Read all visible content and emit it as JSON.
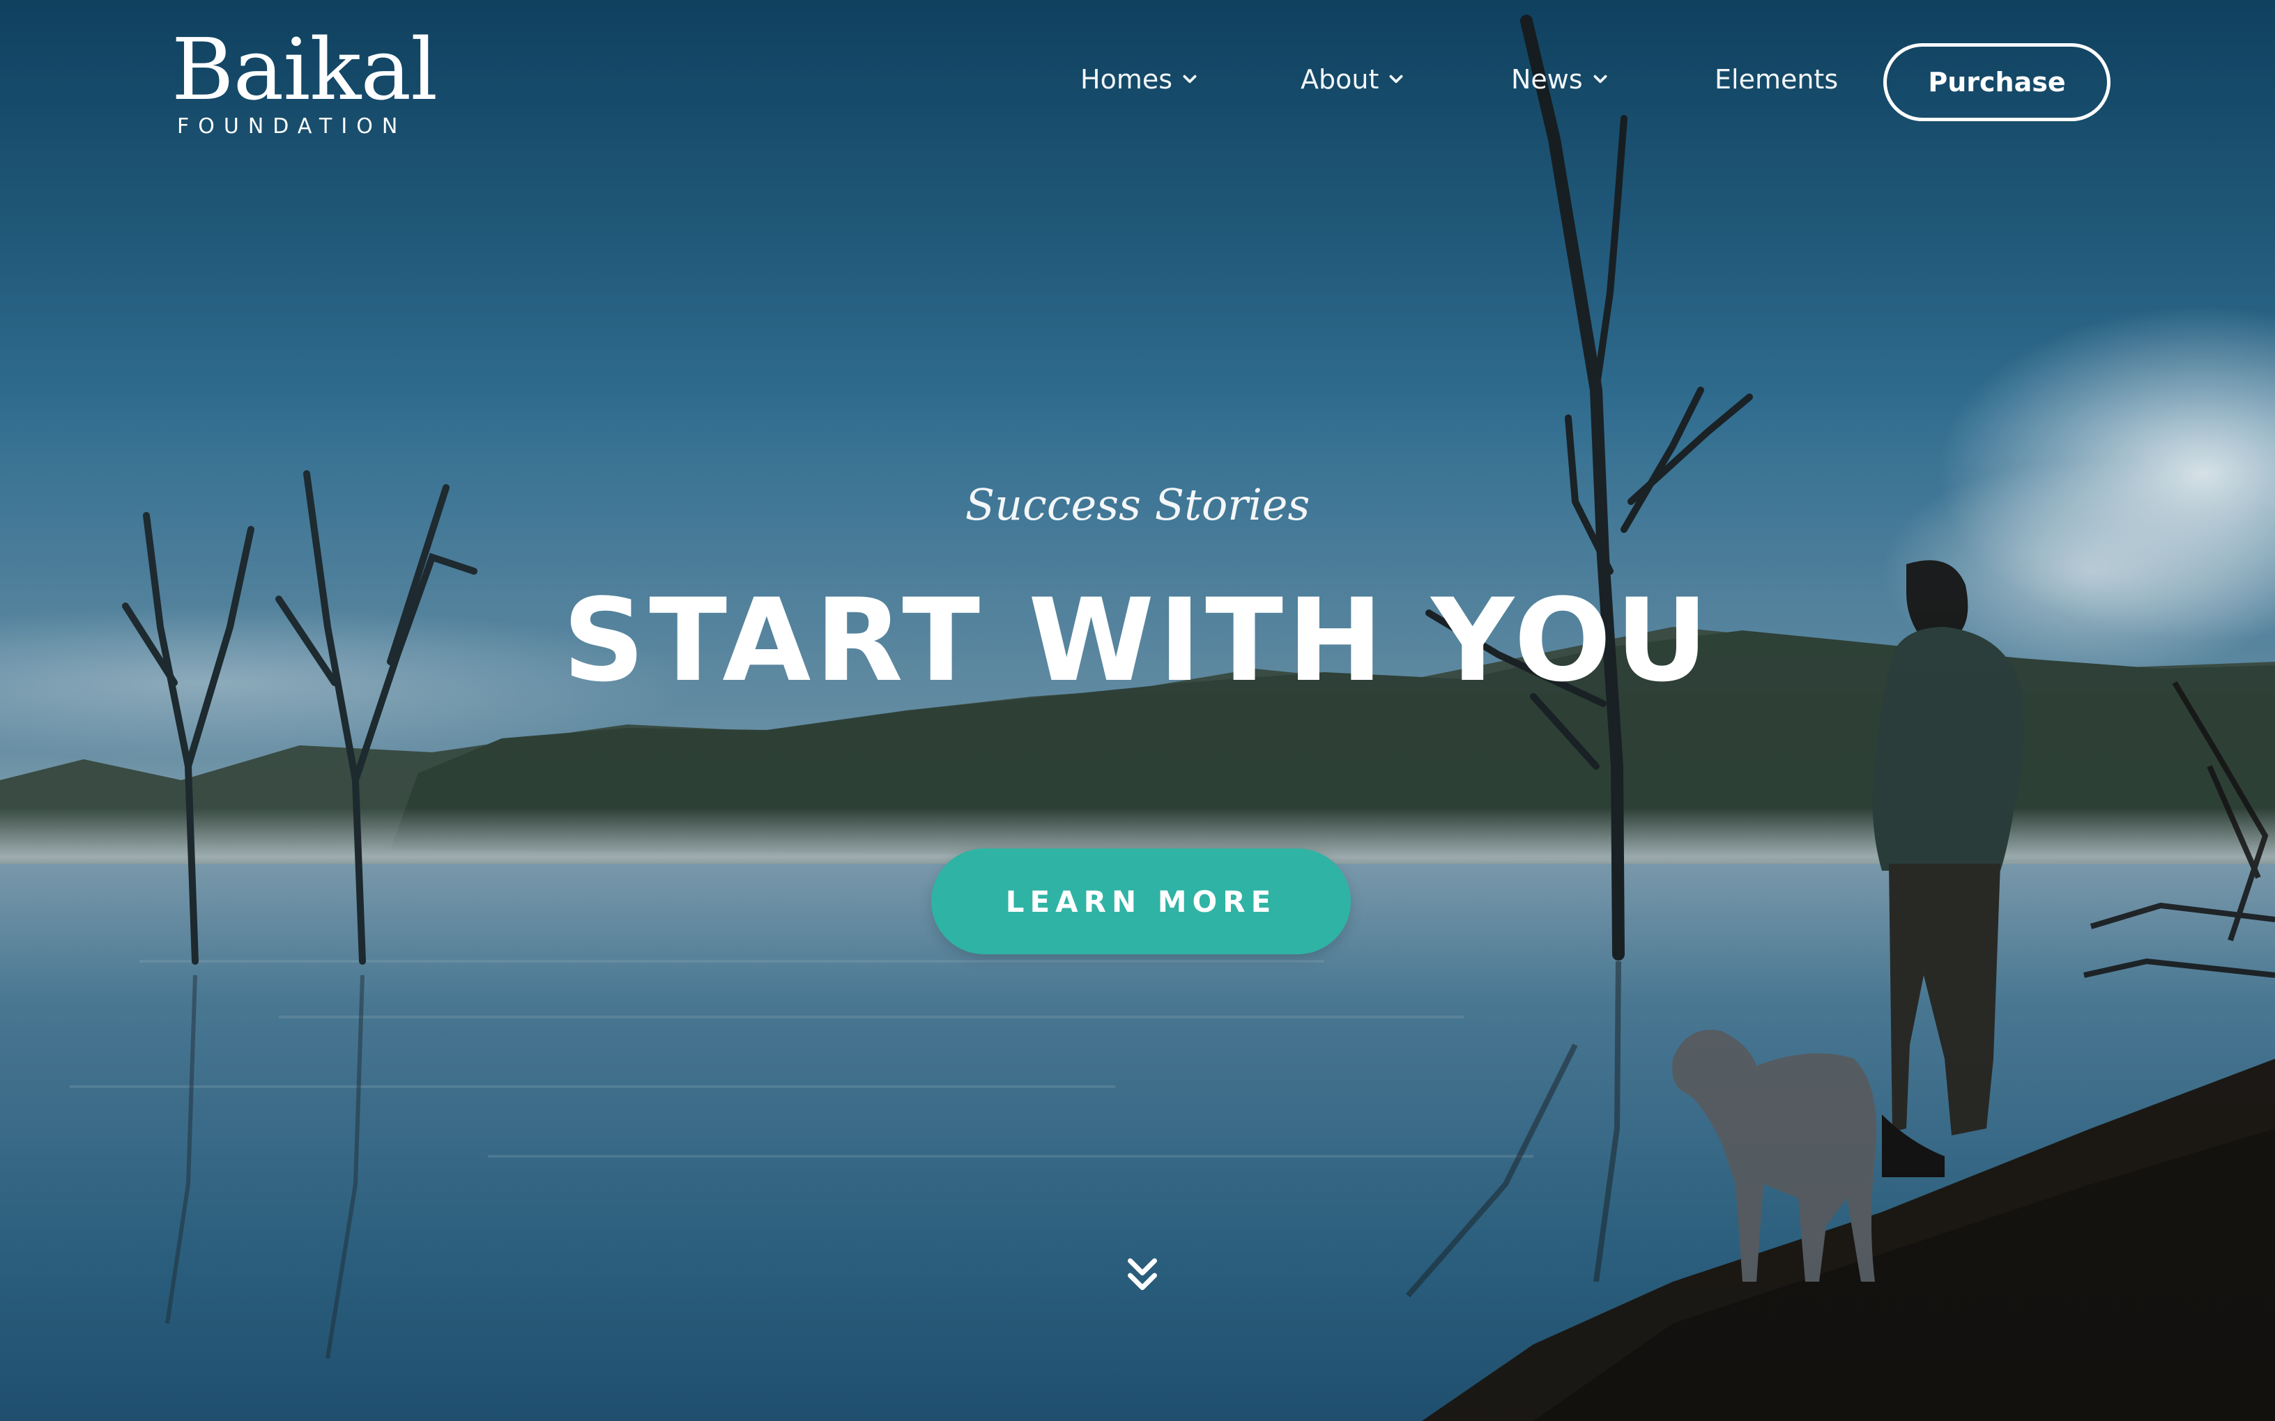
{
  "brand": {
    "name": "Baikal",
    "tagline": "FOUNDATION"
  },
  "nav": {
    "items": [
      {
        "label": "Homes",
        "icon": "chevron-down-icon"
      },
      {
        "label": "About",
        "icon": "chevron-down-icon"
      },
      {
        "label": "News",
        "icon": "chevron-down-icon"
      },
      {
        "label": "Elements"
      }
    ],
    "purchase_label": "Purchase"
  },
  "hero": {
    "eyebrow": "Success Stories",
    "headline": "START WITH YOU",
    "cta_label": "LEARN MORE",
    "scroll_icon": "double-chevron-down-icon"
  },
  "colors": {
    "accent": "#2fb3a4",
    "sky_top": "#1b5f86",
    "water": "#3f7896",
    "text": "#ffffff"
  }
}
